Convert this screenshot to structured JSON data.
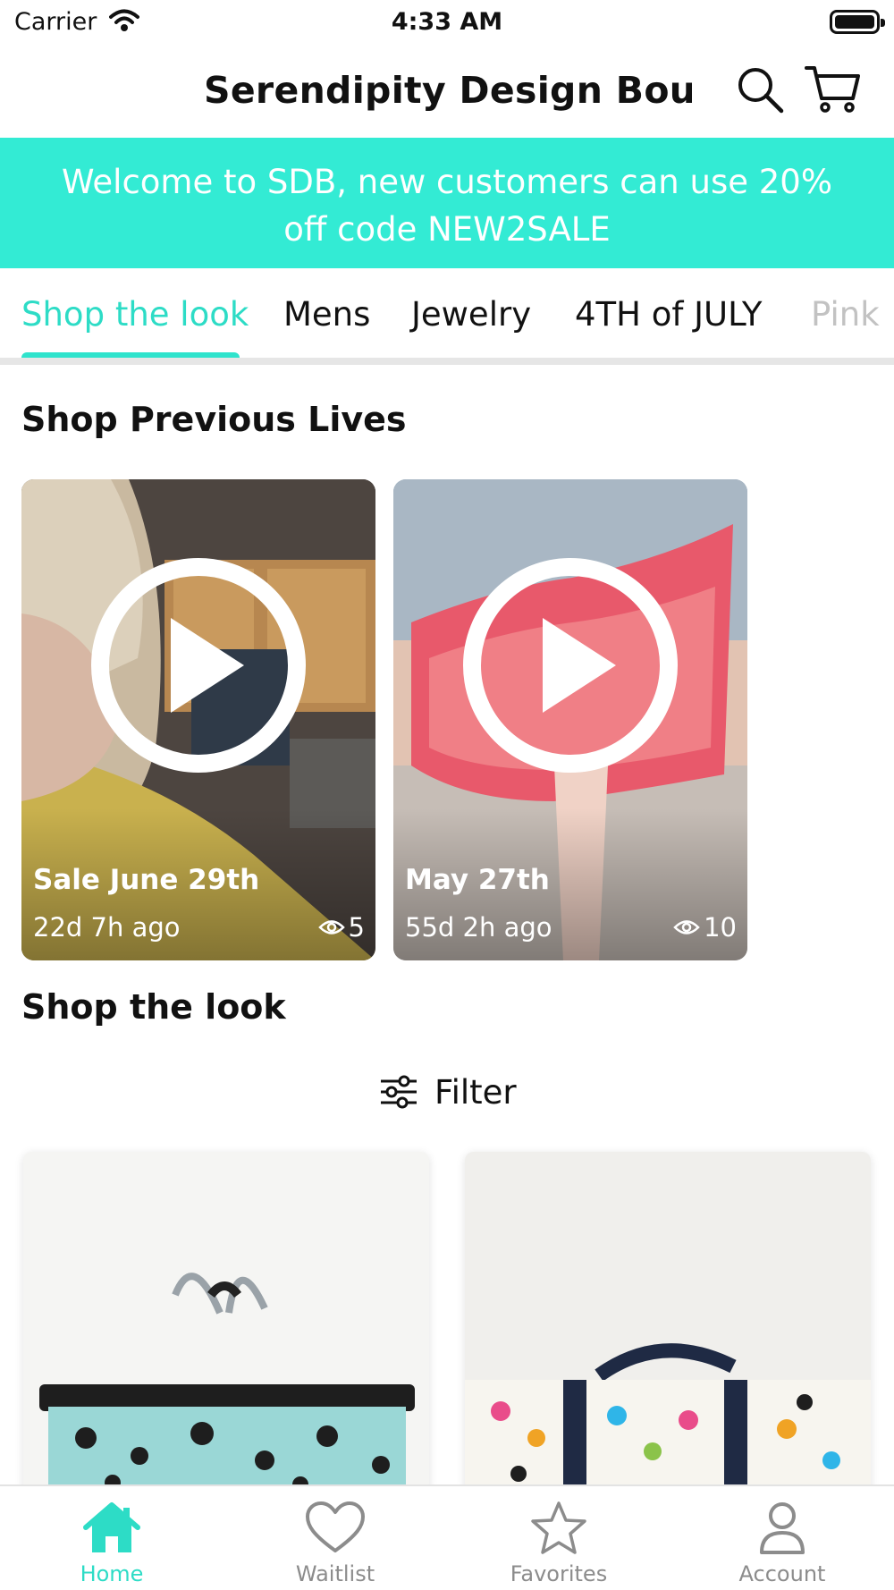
{
  "status_bar": {
    "carrier": "Carrier",
    "time": "4:33 AM"
  },
  "header": {
    "title": "Serendipity Design Bout...",
    "search_icon": "search-icon",
    "cart_icon": "cart-icon"
  },
  "banner": {
    "text": "Welcome to SDB, new customers can use 20% off code NEW2SALE"
  },
  "tabs": [
    {
      "label": "Shop the look",
      "active": true
    },
    {
      "label": "Mens"
    },
    {
      "label": "Jewelry"
    },
    {
      "label": "4TH of JULY"
    },
    {
      "label": "Pink"
    }
  ],
  "previous_lives": {
    "heading": "Shop Previous Lives",
    "items": [
      {
        "title": "Sale June 29th",
        "time_ago": "22d 7h ago",
        "views": "5"
      },
      {
        "title": "May 27th",
        "time_ago": "55d 2h ago",
        "views": "10"
      }
    ]
  },
  "shop_the_look": {
    "heading": "Shop the look",
    "filter_label": "Filter"
  },
  "bottom_tabs": [
    {
      "label": "Home",
      "icon": "home-icon",
      "active": true
    },
    {
      "label": "Waitlist",
      "icon": "heart-icon"
    },
    {
      "label": "Favorites",
      "icon": "star-icon"
    },
    {
      "label": "Account",
      "icon": "person-icon"
    }
  ],
  "colors": {
    "accent": "#2ddcc6",
    "banner": "#33ebd4",
    "inactive": "#8c8c8c"
  }
}
